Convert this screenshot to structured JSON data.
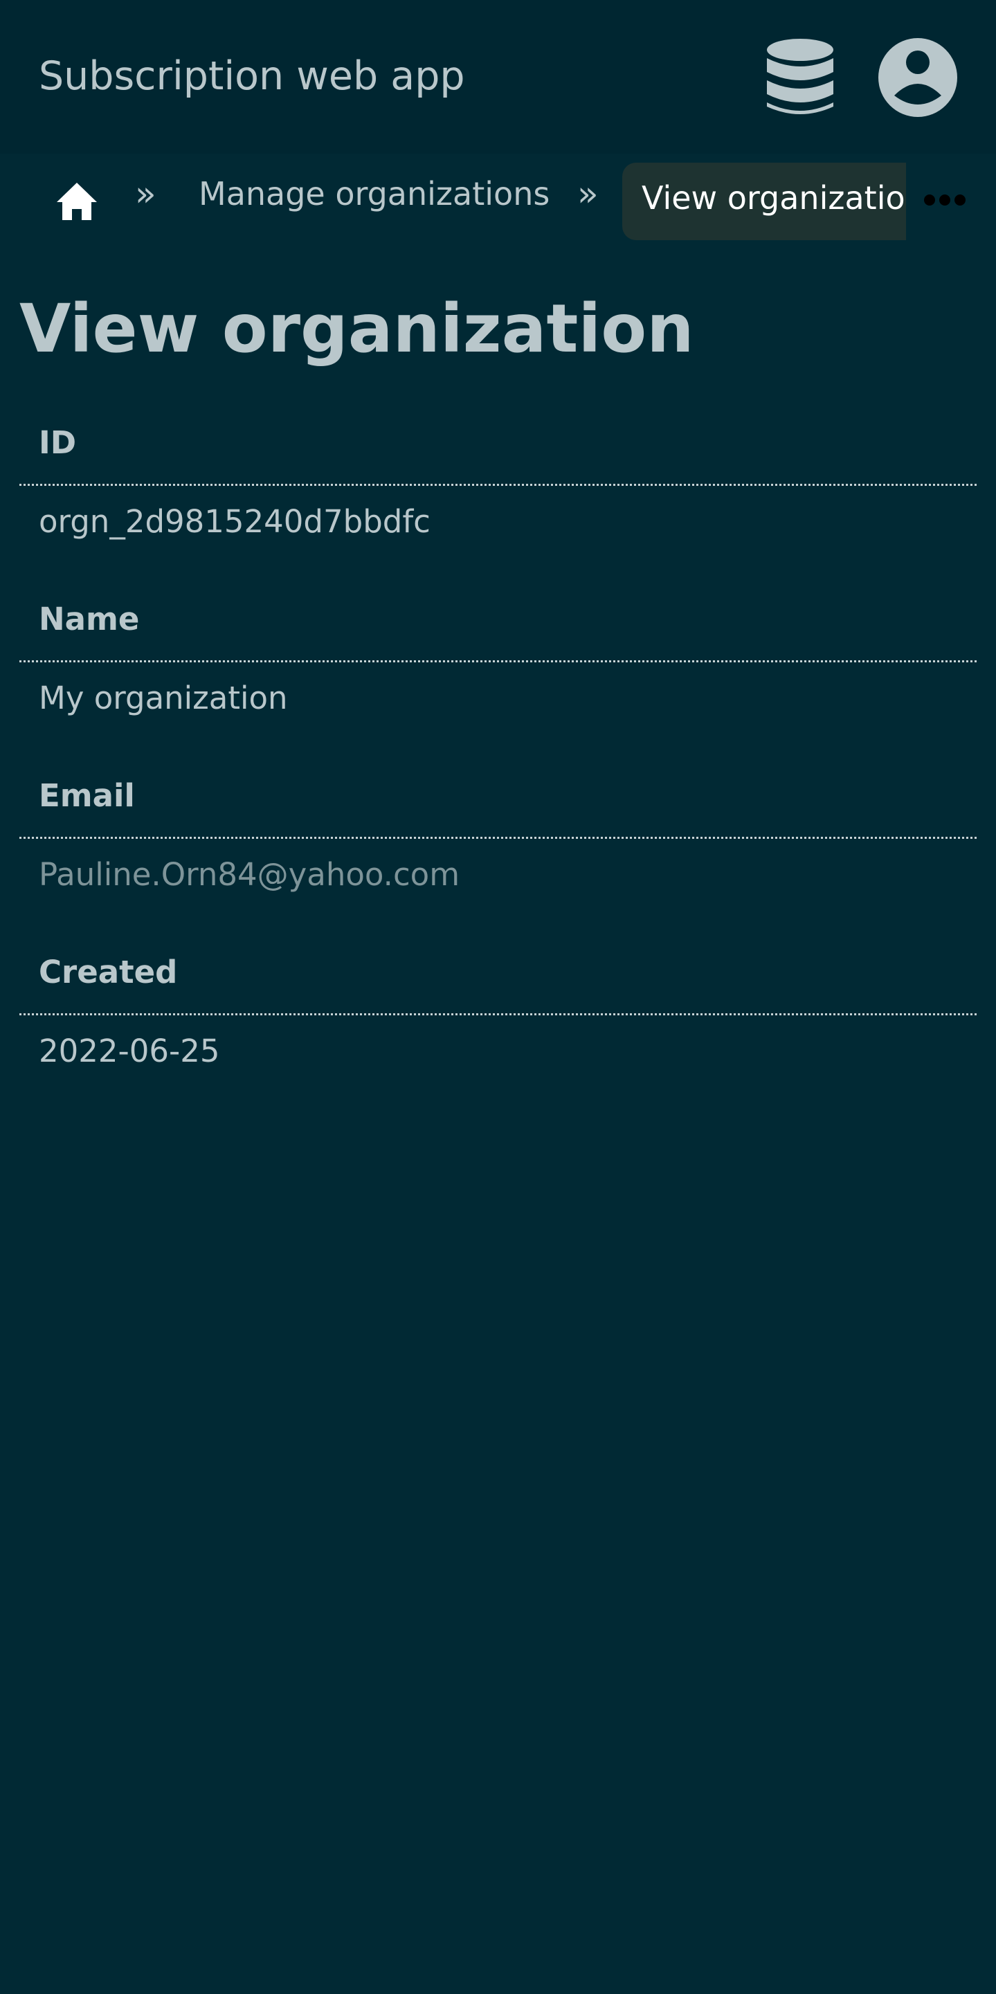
{
  "header": {
    "app_title": "Subscription web app",
    "icons": {
      "database": "database-icon",
      "user": "user-circle-icon"
    }
  },
  "breadcrumb": {
    "home_icon": "home-icon",
    "separator": "»",
    "items": [
      {
        "label": "Manage organizations"
      },
      {
        "label": "View organization"
      }
    ],
    "more_icon": "more-horizontal-icon"
  },
  "page": {
    "title": "View organization"
  },
  "fields": [
    {
      "label": "ID",
      "value": "orgn_2d9815240d7bbdfc"
    },
    {
      "label": "Name",
      "value": "My organization"
    },
    {
      "label": "Email",
      "value": "Pauline.Orn84@yahoo.com"
    },
    {
      "label": "Created",
      "value": "2022-06-25"
    }
  ],
  "colors": {
    "background": "#012934",
    "header_background": "#002631",
    "text": "#b9c7cb",
    "muted_text": "#7e9499",
    "active_crumb_background": "#1e3331",
    "active_crumb_text": "#ffffff"
  }
}
